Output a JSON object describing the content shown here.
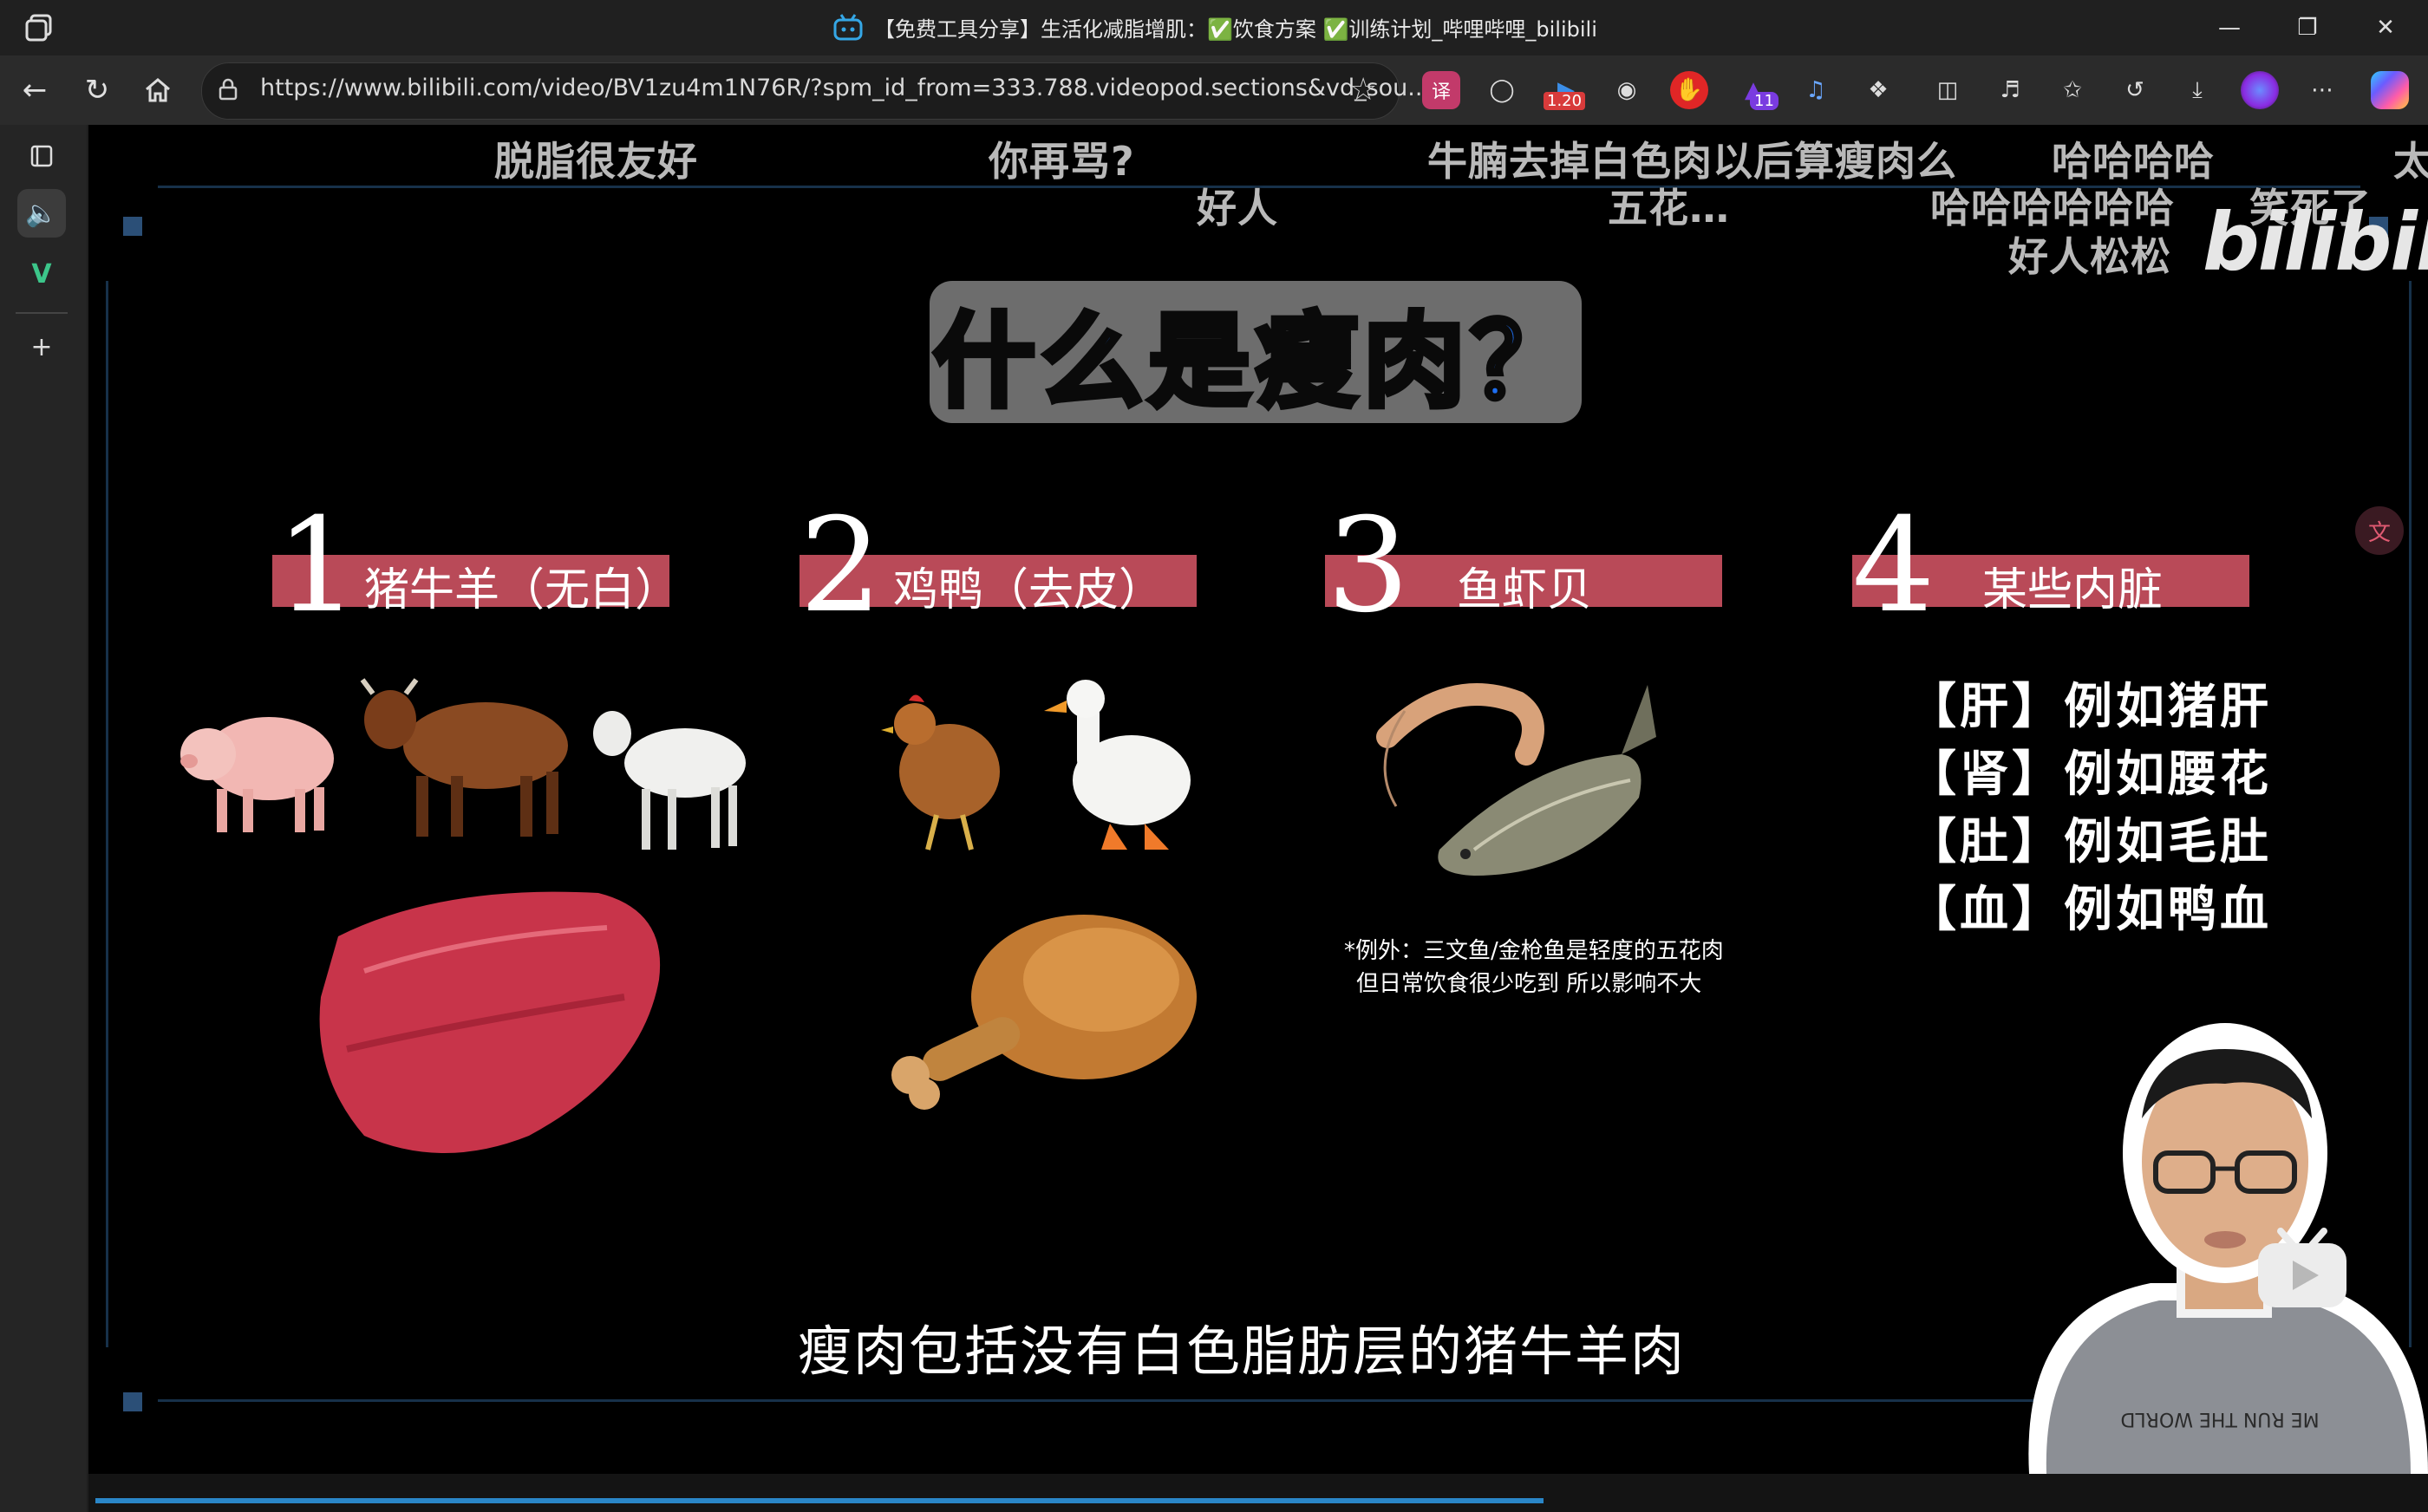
{
  "window": {
    "title": "【免费工具分享】生活化减脂增肌：✅饮食方案 ✅训练计划_哔哩哔哩_bilibili"
  },
  "address_bar": {
    "url": "https://www.bilibili.com/video/BV1zu4m1N76R/?spm_id_from=333.788.videopod.sections&vd_sou..."
  },
  "extensions": {
    "badge_speed": "1.20",
    "badge_count": "11"
  },
  "danmaku": [
    "脱脂很友好",
    "你再骂?",
    "好人",
    "牛腩去掉白色肉以后算瘦肉么",
    "五花…",
    "哈哈哈哈",
    "哈哈哈哈哈哈",
    "笑死了",
    "好人松松",
    "太"
  ],
  "video": {
    "watermark": "bilibili",
    "headline": "什么是瘦肉？",
    "categories": [
      {
        "number": "1",
        "label": "猪牛羊（无白）"
      },
      {
        "number": "2",
        "label": "鸡鸭（去皮）"
      },
      {
        "number": "3",
        "label": "鱼虾贝"
      },
      {
        "number": "4",
        "label": "某些内脏"
      }
    ],
    "organs": [
      "【肝】例如猪肝",
      "【肾】例如腰花",
      "【肚】例如毛肚",
      "【血】例如鸭血"
    ],
    "note_line1": "*例外：三文鱼/金枪鱼是轻度的五花肉",
    "note_line2": "但日常饮食很少吃到  所以影响不大",
    "subtitle": "瘦肉包括没有白色脂肪层的猪牛羊肉",
    "shirt_text": "ME RUN THE WORLD"
  },
  "colors": {
    "category_bar": "#b94a58",
    "headline_text": "#1e6ff2",
    "progress": "#2a86c8"
  }
}
